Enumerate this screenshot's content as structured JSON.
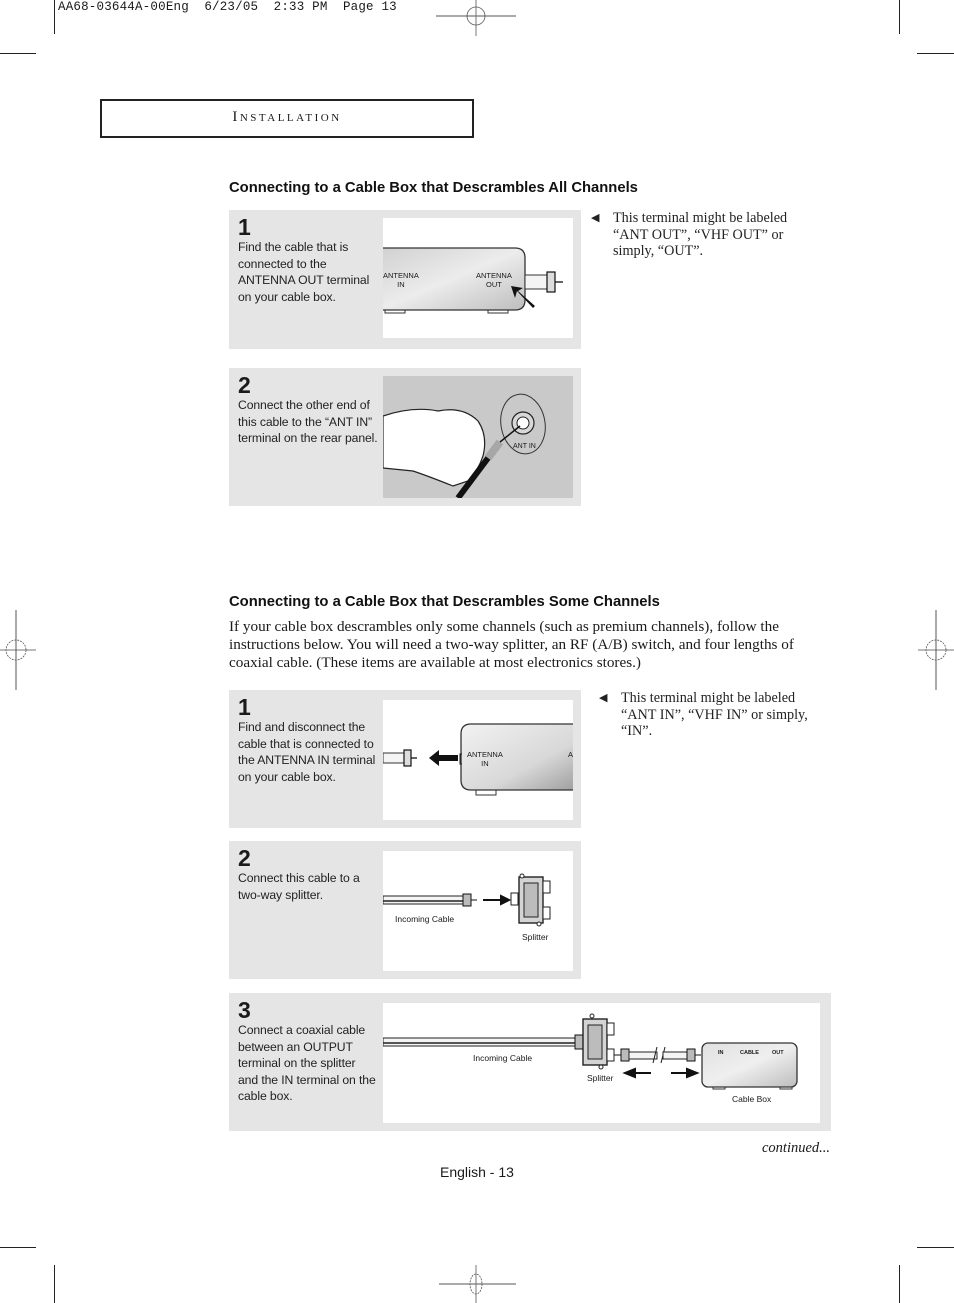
{
  "print_slug": "AA68-03644A-00Eng  6/23/05  2:33 PM  Page 13",
  "section_title": "Installation",
  "section_all": {
    "heading": "Connecting to a Cable Box that Descrambles All Channels",
    "steps": [
      {
        "number": "1",
        "text": "Find the cable that is connected to the ANTENNA OUT terminal on your cable box.",
        "figure_labels": {
          "left": "ANTENNA\nIN",
          "right": "ANTENNA\nOUT"
        },
        "note": "This terminal might be labeled “ANT OUT”, “VHF OUT” or simply, “OUT”."
      },
      {
        "number": "2",
        "text": "Connect the other end of this cable to the “ANT IN” terminal on the  rear panel.",
        "figure_labels": {
          "terminal": "ANT IN"
        }
      }
    ]
  },
  "section_some": {
    "heading": "Connecting to a Cable Box that Descrambles Some Channels",
    "intro": "If your cable box descrambles only some channels (such as premium channels), follow the instructions below. You will need a two-way splitter, an RF (A/B) switch, and four lengths of coaxial cable. (These items are available at most electronics stores.)",
    "steps": [
      {
        "number": "1",
        "text": "Find and disconnect the cable that is connected to the ANTENNA IN terminal on your cable box.",
        "figure_labels": {
          "left": "ANTENNA\nIN",
          "right": "A"
        },
        "note": "This terminal might be labeled “ANT IN”, “VHF IN” or simply, “IN”."
      },
      {
        "number": "2",
        "text": "Connect this cable to a two-way splitter.",
        "figure_labels": {
          "cable": "Incoming Cable",
          "splitter": "Splitter"
        }
      },
      {
        "number": "3",
        "text": "Connect a coaxial cable between an OUTPUT terminal on the splitter and the IN terminal on the cable box.",
        "figure_labels": {
          "cable": "Incoming Cable",
          "splitter": "Splitter",
          "box": "Cable Box",
          "in": "IN",
          "cable_port": "CABLE",
          "out": "OUT"
        }
      }
    ]
  },
  "continued": "continued...",
  "page_footer": "English - 13"
}
